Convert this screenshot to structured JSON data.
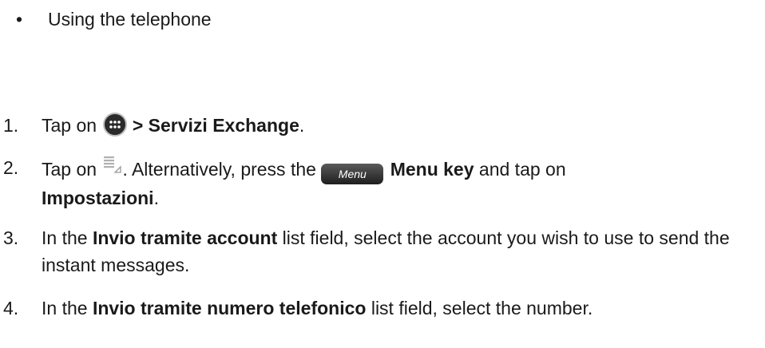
{
  "bullet": {
    "glyph": "•",
    "text": "Using the telephone"
  },
  "steps": [
    {
      "number": "1.",
      "part1": "Tap on ",
      "bold1": "> Servizi Exchange",
      "part2": "."
    },
    {
      "number": "2.",
      "part1": "Tap on ",
      "part2": ". Alternatively, press the ",
      "key_label": "Menu",
      "bold1": "Menu key",
      "part3": " and tap on ",
      "bold2": "Impostazioni",
      "part4": "."
    },
    {
      "number": "3.",
      "part1": "In the ",
      "bold1": "Invio tramite account",
      "part2": " list field, select the account you wish to use to send the instant messages."
    },
    {
      "number": "4.",
      "part1": "In the ",
      "bold1": "Invio tramite numero telefonico",
      "part2": " list field, select the number."
    }
  ],
  "icons": {
    "apps": "apps-grid-icon",
    "menu_lines": "menu-lines-icon",
    "menu_key": "menu-key-icon"
  }
}
